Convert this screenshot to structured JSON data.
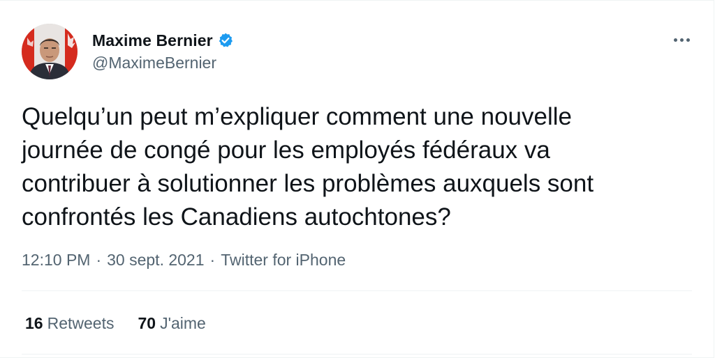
{
  "user": {
    "display_name": "Maxime Bernier",
    "handle": "@MaximeBernier"
  },
  "icons": {
    "verified": "verified-badge-icon",
    "more": "more-options-icon"
  },
  "colors": {
    "verified": "#1d9bf0",
    "secondary_text": "#536471",
    "primary_text": "#0f1419",
    "avatar_flag_red": "#d52b1e"
  },
  "tweet": {
    "lines": [
      "Quelqu’un peut m’expliquer comment une nouvelle",
      "journée de congé pour les employés fédéraux va",
      "contribuer à solutionner les problèmes auxquels sont",
      "confrontés les Canadiens autochtones?"
    ]
  },
  "meta": {
    "time": "12:10 PM",
    "separator": "·",
    "date": "30 sept. 2021",
    "source": "Twitter for iPhone"
  },
  "stats": {
    "retweets_count": "16",
    "retweets_label": "Retweets",
    "likes_count": "70",
    "likes_label": "J'aime"
  }
}
